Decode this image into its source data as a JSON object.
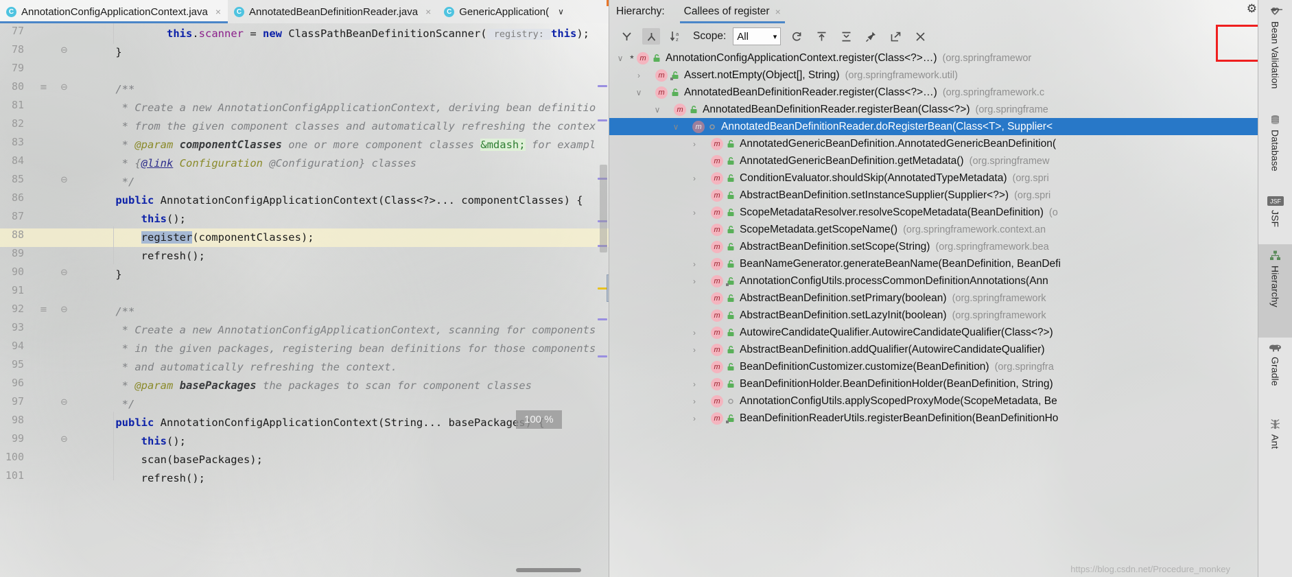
{
  "editor": {
    "tabs": [
      {
        "label": "AnnotationConfigApplicationContext.java",
        "icon": "class-icon",
        "active": true,
        "close": "×"
      },
      {
        "label": "AnnotatedBeanDefinitionReader.java",
        "icon": "class-icon",
        "active": false,
        "close": "×"
      },
      {
        "label": "GenericApplication(",
        "icon": "class-icon",
        "active": false,
        "close": "",
        "chevron": "∨"
      }
    ],
    "zoom_badge": "100 %",
    "line_numbers": [
      "77",
      "78",
      "79",
      "80",
      "81",
      "82",
      "83",
      "84",
      "85",
      "86",
      "87",
      "88",
      "89",
      "90",
      "91",
      "92",
      "93",
      "94",
      "95",
      "96",
      "97",
      "98",
      "99",
      "100",
      "101"
    ],
    "lines": [
      {
        "n": "77",
        "segments": [
          {
            "t": "            ",
            "c": "pl"
          },
          {
            "t": "this",
            "c": "kw"
          },
          {
            "t": ".",
            "c": "pl"
          },
          {
            "t": "scanner",
            "c": "fld"
          },
          {
            "t": " = ",
            "c": "pl"
          },
          {
            "t": "new",
            "c": "kw"
          },
          {
            "t": " ClassPathBeanDefinitionScanner(",
            "c": "pl"
          },
          {
            "t": " registry: ",
            "c": "hint"
          },
          {
            "t": "this",
            "c": "kw"
          },
          {
            "t": ");",
            "c": "pl"
          }
        ]
      },
      {
        "n": "78",
        "segments": [
          {
            "t": "    }",
            "c": "pl"
          }
        ]
      },
      {
        "n": "79",
        "segments": []
      },
      {
        "n": "80",
        "segments": [
          {
            "t": "    /**",
            "c": "cm"
          }
        ]
      },
      {
        "n": "81",
        "segments": [
          {
            "t": "     * Create a new AnnotationConfigApplicationContext, deriving bean definitio",
            "c": "cm"
          }
        ]
      },
      {
        "n": "82",
        "segments": [
          {
            "t": "     * from the given component classes and automatically refreshing the contex",
            "c": "cm"
          }
        ]
      },
      {
        "n": "83",
        "segments": [
          {
            "t": "     * ",
            "c": "cm"
          },
          {
            "t": "@param",
            "c": "tag"
          },
          {
            "t": " componentClasses",
            "c": "cmb"
          },
          {
            "t": " one or more component classes ",
            "c": "cm"
          },
          {
            "t": "&mdash;",
            "c": "ent"
          },
          {
            "t": " for exampl",
            "c": "cm"
          }
        ]
      },
      {
        "n": "84",
        "segments": [
          {
            "t": "     * {",
            "c": "cm"
          },
          {
            "t": "@link",
            "c": "lnk"
          },
          {
            "t": " ",
            "c": "cm"
          },
          {
            "t": "Configuration",
            "c": "tag"
          },
          {
            "t": " @Configuration} classes",
            "c": "cm"
          }
        ]
      },
      {
        "n": "85",
        "segments": [
          {
            "t": "     */",
            "c": "cm"
          }
        ]
      },
      {
        "n": "86",
        "segments": [
          {
            "t": "    ",
            "c": "pl"
          },
          {
            "t": "public",
            "c": "kw"
          },
          {
            "t": " AnnotationConfigApplicationContext(Class<?>... componentClasses) {",
            "c": "pl"
          }
        ]
      },
      {
        "n": "87",
        "segments": [
          {
            "t": "        ",
            "c": "pl"
          },
          {
            "t": "this",
            "c": "kw"
          },
          {
            "t": "();",
            "c": "pl"
          }
        ]
      },
      {
        "n": "88",
        "segments": [
          {
            "t": "        ",
            "c": "pl"
          },
          {
            "t": "register",
            "c": "sel"
          },
          {
            "t": "(componentClasses);",
            "c": "pl"
          }
        ]
      },
      {
        "n": "89",
        "segments": [
          {
            "t": "        refresh();",
            "c": "pl"
          }
        ]
      },
      {
        "n": "90",
        "segments": [
          {
            "t": "    }",
            "c": "pl"
          }
        ]
      },
      {
        "n": "91",
        "segments": []
      },
      {
        "n": "92",
        "segments": [
          {
            "t": "    /**",
            "c": "cm"
          }
        ]
      },
      {
        "n": "93",
        "segments": [
          {
            "t": "     * Create a new AnnotationConfigApplicationContext, scanning for components",
            "c": "cm"
          }
        ]
      },
      {
        "n": "94",
        "segments": [
          {
            "t": "     * in the given packages, registering bean definitions for those components",
            "c": "cm"
          }
        ]
      },
      {
        "n": "95",
        "segments": [
          {
            "t": "     * and automatically refreshing the context.",
            "c": "cm"
          }
        ]
      },
      {
        "n": "96",
        "segments": [
          {
            "t": "     * ",
            "c": "cm"
          },
          {
            "t": "@param",
            "c": "tag"
          },
          {
            "t": " basePackages",
            "c": "cmb"
          },
          {
            "t": " the packages to scan for component classes",
            "c": "cm"
          }
        ]
      },
      {
        "n": "97",
        "segments": [
          {
            "t": "     */",
            "c": "cm"
          }
        ]
      },
      {
        "n": "98",
        "segments": [
          {
            "t": "    ",
            "c": "pl"
          },
          {
            "t": "public",
            "c": "kw"
          },
          {
            "t": " AnnotationConfigApplicationContext(String... basePackages) {",
            "c": "pl"
          }
        ]
      },
      {
        "n": "99",
        "segments": [
          {
            "t": "        ",
            "c": "pl"
          },
          {
            "t": "this",
            "c": "kw"
          },
          {
            "t": "();",
            "c": "pl"
          }
        ]
      },
      {
        "n": "100",
        "segments": [
          {
            "t": "        scan(basePackages);",
            "c": "pl"
          }
        ]
      },
      {
        "n": "101",
        "segments": [
          {
            "t": "        refresh();",
            "c": "pl"
          }
        ]
      }
    ]
  },
  "hierarchy": {
    "title": "Hierarchy:",
    "tab_label": "Callees of register",
    "tab_close": "×",
    "toolbar": {
      "callers_icon": "call-hierarchy-callers-icon",
      "callees_icon": "call-hierarchy-callees-icon",
      "sort_icon": "sort-alphabetically-icon",
      "scope_label": "Scope:",
      "scope_value": "All",
      "refresh_icon": "refresh-icon",
      "expand_icon": "export-to-textfile-icon",
      "collapse_icon": "collapse-all-icon",
      "pin_icon": "pin-tab-icon",
      "open_icon": "open-in-new-window-icon",
      "close_icon": "close-icon"
    },
    "tree": [
      {
        "indent": 0,
        "twisty": "∨",
        "star": "*",
        "marker": "m",
        "vis": "public",
        "label": "AnnotationConfigApplicationContext.register(Class<?>…)",
        "pkg": "(org.springframewor",
        "selected": false
      },
      {
        "indent": 1,
        "twisty": "›",
        "star": "",
        "marker": "m",
        "vis": "public-static",
        "label": "Assert.notEmpty(Object[], String)",
        "pkg": "(org.springframework.util)",
        "selected": false
      },
      {
        "indent": 1,
        "twisty": "∨",
        "star": "",
        "marker": "m",
        "vis": "public",
        "label": "AnnotatedBeanDefinitionReader.register(Class<?>…)",
        "pkg": "(org.springframework.c",
        "selected": false
      },
      {
        "indent": 2,
        "twisty": "∨",
        "star": "",
        "marker": "m",
        "vis": "public",
        "label": "AnnotatedBeanDefinitionReader.registerBean(Class<?>)",
        "pkg": "(org.springframe",
        "selected": false
      },
      {
        "indent": 3,
        "twisty": "∨",
        "star": "",
        "marker": "m",
        "vis": "private",
        "label": "AnnotatedBeanDefinitionReader.doRegisterBean(Class<T>, Supplier<",
        "pkg": "",
        "selected": true
      },
      {
        "indent": 4,
        "twisty": "›",
        "star": "",
        "marker": "m",
        "vis": "public",
        "label": "AnnotatedGenericBeanDefinition.AnnotatedGenericBeanDefinition(",
        "pkg": "",
        "selected": false
      },
      {
        "indent": 4,
        "twisty": "",
        "star": "",
        "marker": "m",
        "vis": "public",
        "label": "AnnotatedGenericBeanDefinition.getMetadata()",
        "pkg": "(org.springframew",
        "selected": false
      },
      {
        "indent": 4,
        "twisty": "›",
        "star": "",
        "marker": "m",
        "vis": "public",
        "label": "ConditionEvaluator.shouldSkip(AnnotatedTypeMetadata)",
        "pkg": "(org.spri",
        "selected": false
      },
      {
        "indent": 4,
        "twisty": "",
        "star": "",
        "marker": "m",
        "vis": "public",
        "label": "AbstractBeanDefinition.setInstanceSupplier(Supplier<?>)",
        "pkg": "(org.spri",
        "selected": false
      },
      {
        "indent": 4,
        "twisty": "›",
        "star": "",
        "marker": "m",
        "vis": "interface",
        "label": "ScopeMetadataResolver.resolveScopeMetadata(BeanDefinition)",
        "pkg": "(o",
        "selected": false
      },
      {
        "indent": 4,
        "twisty": "",
        "star": "",
        "marker": "m",
        "vis": "public",
        "label": "ScopeMetadata.getScopeName()",
        "pkg": "(org.springframework.context.an",
        "selected": false
      },
      {
        "indent": 4,
        "twisty": "",
        "star": "",
        "marker": "m",
        "vis": "public",
        "label": "AbstractBeanDefinition.setScope(String)",
        "pkg": "(org.springframework.bea",
        "selected": false
      },
      {
        "indent": 4,
        "twisty": "›",
        "star": "",
        "marker": "m",
        "vis": "interface",
        "label": "BeanNameGenerator.generateBeanName(BeanDefinition, BeanDefi",
        "pkg": "",
        "selected": false
      },
      {
        "indent": 4,
        "twisty": "›",
        "star": "",
        "marker": "m",
        "vis": "public-static",
        "label": "AnnotationConfigUtils.processCommonDefinitionAnnotations(Ann",
        "pkg": "",
        "selected": false
      },
      {
        "indent": 4,
        "twisty": "",
        "star": "",
        "marker": "m",
        "vis": "public",
        "label": "AbstractBeanDefinition.setPrimary(boolean)",
        "pkg": "(org.springframework",
        "selected": false
      },
      {
        "indent": 4,
        "twisty": "",
        "star": "",
        "marker": "m",
        "vis": "public",
        "label": "AbstractBeanDefinition.setLazyInit(boolean)",
        "pkg": "(org.springframework",
        "selected": false
      },
      {
        "indent": 4,
        "twisty": "›",
        "star": "",
        "marker": "m",
        "vis": "public",
        "label": "AutowireCandidateQualifier.AutowireCandidateQualifier(Class<?>)",
        "pkg": "",
        "selected": false
      },
      {
        "indent": 4,
        "twisty": "›",
        "star": "",
        "marker": "m",
        "vis": "public",
        "label": "AbstractBeanDefinition.addQualifier(AutowireCandidateQualifier)",
        "pkg": "",
        "selected": false
      },
      {
        "indent": 4,
        "twisty": "",
        "star": "",
        "marker": "m",
        "vis": "interface",
        "label": "BeanDefinitionCustomizer.customize(BeanDefinition)",
        "pkg": "(org.springfra",
        "selected": false
      },
      {
        "indent": 4,
        "twisty": "›",
        "star": "",
        "marker": "m",
        "vis": "public",
        "label": "BeanDefinitionHolder.BeanDefinitionHolder(BeanDefinition, String)",
        "pkg": "",
        "selected": false
      },
      {
        "indent": 4,
        "twisty": "›",
        "star": "",
        "marker": "m",
        "vis": "private-static",
        "label": "AnnotationConfigUtils.applyScopedProxyMode(ScopeMetadata, Be",
        "pkg": "",
        "selected": false
      },
      {
        "indent": 4,
        "twisty": "›",
        "star": "",
        "marker": "m",
        "vis": "public-static",
        "label": "BeanDefinitionReaderUtils.registerBeanDefinition(BeanDefinitionHo",
        "pkg": "",
        "selected": false
      }
    ]
  },
  "rail": {
    "items": [
      {
        "label": "Bean Validation",
        "icon": "bean-validation-icon",
        "active": false
      },
      {
        "label": "Database",
        "icon": "database-icon",
        "active": false
      },
      {
        "label": "JSF",
        "icon": "jsf-icon",
        "active": false
      },
      {
        "label": "Hierarchy",
        "icon": "hierarchy-icon",
        "active": true
      },
      {
        "label": "Gradle",
        "icon": "gradle-elephant-icon",
        "active": false
      },
      {
        "label": "Ant",
        "icon": "ant-icon",
        "active": false
      }
    ]
  },
  "window_controls": {
    "settings_icon": "gear-icon",
    "minimize_icon": "minimize-icon"
  },
  "watermark": "https://blog.csdn.net/Procedure_monkey",
  "colors": {
    "selection_blue": "#2878c8",
    "tab_underline": "#4a86c8",
    "red_highlight": "#ef1f1f",
    "keyword": "#0c21a8",
    "comment": "#7f8184"
  }
}
